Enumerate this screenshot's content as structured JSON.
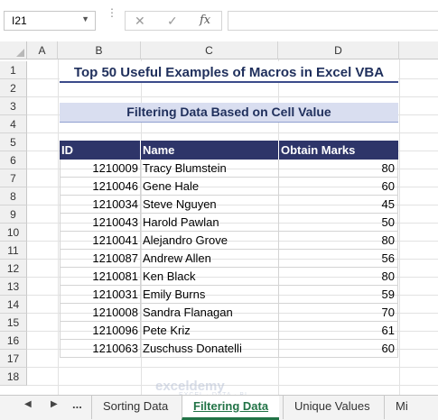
{
  "formula_bar": {
    "name_box": "I21",
    "cancel_icon": "✕",
    "enter_icon": "✓",
    "fx_label": "fx",
    "formula_value": ""
  },
  "columns": [
    "A",
    "B",
    "C",
    "D"
  ],
  "rows": [
    "1",
    "2",
    "3",
    "4",
    "5",
    "6",
    "7",
    "8",
    "9",
    "10",
    "11",
    "12",
    "13",
    "14",
    "15",
    "16",
    "17",
    "18"
  ],
  "sheet": {
    "title": "Top 50 Useful Examples of Macros in Excel VBA",
    "subtitle": "Filtering Data Based on Cell Value",
    "headers": {
      "id": "ID",
      "name": "Name",
      "marks": "Obtain Marks"
    },
    "records": [
      {
        "id": "1210009",
        "name": "Tracy Blumstein",
        "marks": "80"
      },
      {
        "id": "1210046",
        "name": "Gene Hale",
        "marks": "60"
      },
      {
        "id": "1210034",
        "name": "Steve Nguyen",
        "marks": "45"
      },
      {
        "id": "1210043",
        "name": "Harold Pawlan",
        "marks": "50"
      },
      {
        "id": "1210041",
        "name": "Alejandro Grove",
        "marks": "80"
      },
      {
        "id": "1210087",
        "name": "Andrew Allen",
        "marks": "56"
      },
      {
        "id": "1210081",
        "name": "Ken Black",
        "marks": "80"
      },
      {
        "id": "1210031",
        "name": "Emily Burns",
        "marks": "59"
      },
      {
        "id": "1210008",
        "name": "Sandra Flanagan",
        "marks": "70"
      },
      {
        "id": "1210096",
        "name": "Pete Kriz",
        "marks": "61"
      },
      {
        "id": "1210063",
        "name": "Zuschuss Donatelli",
        "marks": "60"
      }
    ]
  },
  "tabs": {
    "more": "...",
    "items": [
      "Sorting Data",
      "Filtering Data",
      "Unique Values",
      "Mi"
    ],
    "active": "Filtering Data"
  },
  "watermark": {
    "brand": "exceldemy",
    "tagline": "EXCEL · DATA · BI"
  },
  "colors": {
    "header_bg": "#2e3569",
    "subtitle_bg": "#d9def0",
    "title_text": "#1f2f5c",
    "active_tab": "#217346"
  }
}
